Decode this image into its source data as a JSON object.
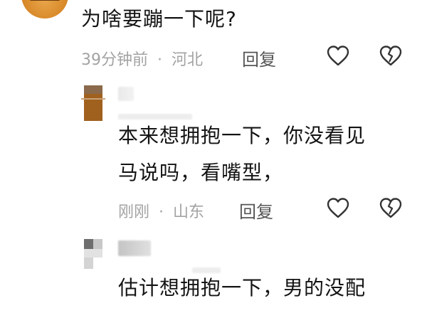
{
  "comments": [
    {
      "text": "为啥要蹦一下呢?",
      "time": "39分钟前",
      "separator": "·",
      "location": "河北",
      "reply_label": "回复"
    }
  ],
  "replies": [
    {
      "text_line1": "本来想拥抱一下，你没看见",
      "text_line2": "马说吗，看嘴型，",
      "time": "刚刚",
      "separator": "·",
      "location": "山东",
      "reply_label": "回复"
    },
    {
      "text_line1": "估计想拥抱一下，男的没配"
    }
  ],
  "icons": {
    "like": "heart-outline-icon",
    "dislike": "broken-heart-icon"
  },
  "colors": {
    "text": "#141414",
    "meta": "#a3a3a3",
    "reply": "#555555",
    "icon_stroke": "#333333"
  }
}
